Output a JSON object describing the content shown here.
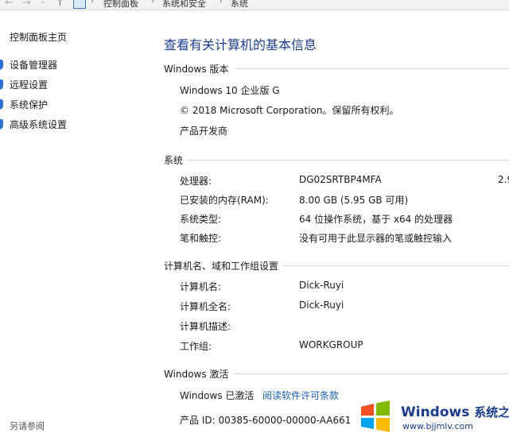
{
  "address_bar": {
    "crumbs": [
      "控制面板",
      "系统和安全",
      "系统"
    ],
    "back_glyph": "←",
    "forward_glyph": "→",
    "up_glyph": "↑",
    "separator_glyph": "›"
  },
  "sidebar": {
    "home": "控制面板主页",
    "items": [
      {
        "label": "设备管理器",
        "icon": "shield-icon"
      },
      {
        "label": "远程设置",
        "icon": "shield-icon"
      },
      {
        "label": "系统保护",
        "icon": "shield-icon"
      },
      {
        "label": "高级系统设置",
        "icon": "shield-icon"
      }
    ],
    "see_also": "另请参阅"
  },
  "main": {
    "title": "查看有关计算机的基本信息",
    "windows_edition": {
      "heading": "Windows 版本",
      "edition": "Windows 10 企业版 G",
      "copyright": "© 2018 Microsoft Corporation。保留所有权利。",
      "developer": "产品开发商"
    },
    "system": {
      "heading": "系统",
      "rows": [
        {
          "label": "处理器:",
          "value": "DG02SRTBP4MFA",
          "extra": "2.9"
        },
        {
          "label": "已安装的内存(RAM):",
          "value": "8.00 GB (5.95 GB 可用)"
        },
        {
          "label": "系统类型:",
          "value": "64 位操作系统，基于 x64 的处理器"
        },
        {
          "label": "笔和触控:",
          "value": "没有可用于此显示器的笔或触控输入"
        }
      ]
    },
    "computer": {
      "heading": "计算机名、域和工作组设置",
      "rows": [
        {
          "label": "计算机名:",
          "value": "Dick-Ruyi"
        },
        {
          "label": "计算机全名:",
          "value": "Dick-Ruyi"
        },
        {
          "label": "计算机描述:",
          "value": ""
        },
        {
          "label": "工作组:",
          "value": "WORKGROUP"
        }
      ]
    },
    "activation": {
      "heading": "Windows 激活",
      "status": "Windows 已激活",
      "license_link": "阅读软件许可条款",
      "product_id": "产品 ID: 00385-60000-00000-AA661"
    }
  },
  "watermark": {
    "brand": "Windows",
    "suffix": "系统之家",
    "url": "www.bjjmlv.com",
    "colors": {
      "red": "#f25022",
      "green": "#7fba00",
      "blue": "#00a4ef",
      "yellow": "#ffb900"
    }
  }
}
